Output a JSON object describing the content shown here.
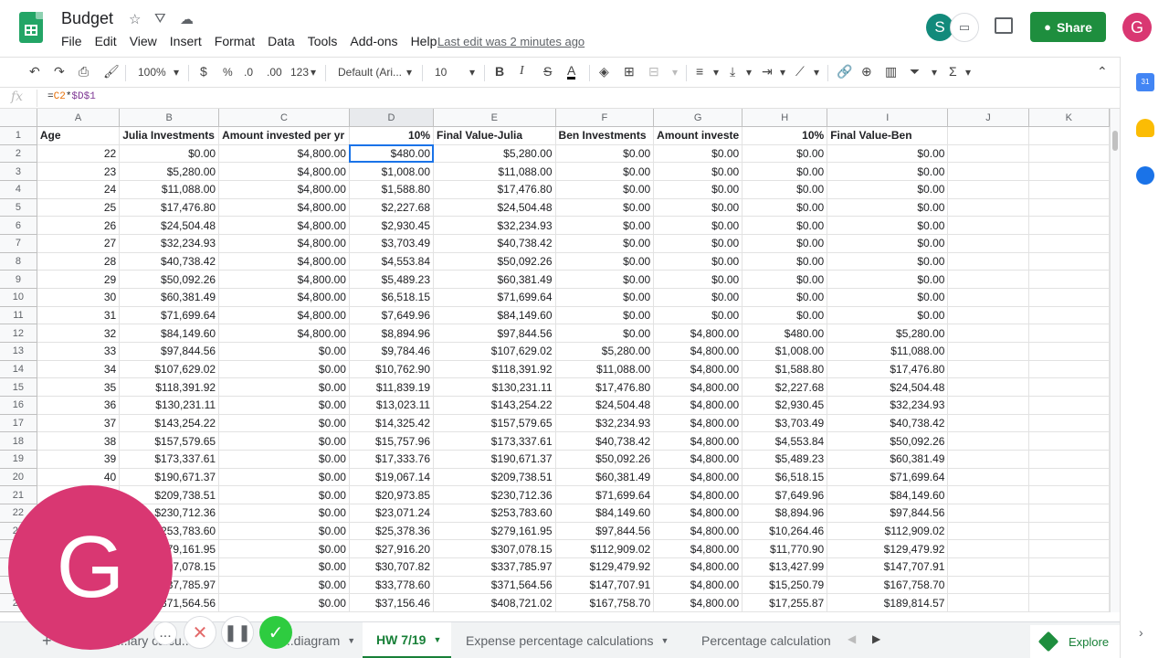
{
  "app": {
    "doc_title": "Budget",
    "last_edit": "Last edit was 2 minutes ago",
    "menu": [
      "File",
      "Edit",
      "View",
      "Insert",
      "Format",
      "Data",
      "Tools",
      "Add-ons",
      "Help"
    ],
    "share_label": "Share",
    "avatar_letter": "G",
    "collab_letter": "S"
  },
  "toolbar": {
    "zoom": "100%",
    "currency": "$",
    "percent": "%",
    "decimal_decrease": ".0",
    "decimal_increase": ".00",
    "number_format": "123",
    "font": "Default (Ari...",
    "font_size": "10",
    "bold": "B",
    "italic": "I",
    "strike": "S",
    "text_color": "A"
  },
  "formula_bar": {
    "fx": "fx",
    "formula_prefix": "=",
    "formula_ref1": "C2",
    "formula_op": "*",
    "formula_ref2": "$D$1"
  },
  "sheet": {
    "columns": [
      "A",
      "B",
      "C",
      "D",
      "E",
      "F",
      "G",
      "H",
      "I",
      "J",
      "K"
    ],
    "header_row": [
      "Age",
      "Julia Investments",
      "Amount invested per yr",
      "10%",
      "Final Value-Julia",
      "Ben Investments",
      "Amount investe",
      "10%",
      "Final Value-Ben",
      "",
      ""
    ],
    "rows": [
      [
        "22",
        "$0.00",
        "$4,800.00",
        "$480.00",
        "$5,280.00",
        "$0.00",
        "$0.00",
        "$0.00",
        "$0.00"
      ],
      [
        "23",
        "$5,280.00",
        "$4,800.00",
        "$1,008.00",
        "$11,088.00",
        "$0.00",
        "$0.00",
        "$0.00",
        "$0.00"
      ],
      [
        "24",
        "$11,088.00",
        "$4,800.00",
        "$1,588.80",
        "$17,476.80",
        "$0.00",
        "$0.00",
        "$0.00",
        "$0.00"
      ],
      [
        "25",
        "$17,476.80",
        "$4,800.00",
        "$2,227.68",
        "$24,504.48",
        "$0.00",
        "$0.00",
        "$0.00",
        "$0.00"
      ],
      [
        "26",
        "$24,504.48",
        "$4,800.00",
        "$2,930.45",
        "$32,234.93",
        "$0.00",
        "$0.00",
        "$0.00",
        "$0.00"
      ],
      [
        "27",
        "$32,234.93",
        "$4,800.00",
        "$3,703.49",
        "$40,738.42",
        "$0.00",
        "$0.00",
        "$0.00",
        "$0.00"
      ],
      [
        "28",
        "$40,738.42",
        "$4,800.00",
        "$4,553.84",
        "$50,092.26",
        "$0.00",
        "$0.00",
        "$0.00",
        "$0.00"
      ],
      [
        "29",
        "$50,092.26",
        "$4,800.00",
        "$5,489.23",
        "$60,381.49",
        "$0.00",
        "$0.00",
        "$0.00",
        "$0.00"
      ],
      [
        "30",
        "$60,381.49",
        "$4,800.00",
        "$6,518.15",
        "$71,699.64",
        "$0.00",
        "$0.00",
        "$0.00",
        "$0.00"
      ],
      [
        "31",
        "$71,699.64",
        "$4,800.00",
        "$7,649.96",
        "$84,149.60",
        "$0.00",
        "$0.00",
        "$0.00",
        "$0.00"
      ],
      [
        "32",
        "$84,149.60",
        "$4,800.00",
        "$8,894.96",
        "$97,844.56",
        "$0.00",
        "$4,800.00",
        "$480.00",
        "$5,280.00"
      ],
      [
        "33",
        "$97,844.56",
        "$0.00",
        "$9,784.46",
        "$107,629.02",
        "$5,280.00",
        "$4,800.00",
        "$1,008.00",
        "$11,088.00"
      ],
      [
        "34",
        "$107,629.02",
        "$0.00",
        "$10,762.90",
        "$118,391.92",
        "$11,088.00",
        "$4,800.00",
        "$1,588.80",
        "$17,476.80"
      ],
      [
        "35",
        "$118,391.92",
        "$0.00",
        "$11,839.19",
        "$130,231.11",
        "$17,476.80",
        "$4,800.00",
        "$2,227.68",
        "$24,504.48"
      ],
      [
        "36",
        "$130,231.11",
        "$0.00",
        "$13,023.11",
        "$143,254.22",
        "$24,504.48",
        "$4,800.00",
        "$2,930.45",
        "$32,234.93"
      ],
      [
        "37",
        "$143,254.22",
        "$0.00",
        "$14,325.42",
        "$157,579.65",
        "$32,234.93",
        "$4,800.00",
        "$3,703.49",
        "$40,738.42"
      ],
      [
        "38",
        "$157,579.65",
        "$0.00",
        "$15,757.96",
        "$173,337.61",
        "$40,738.42",
        "$4,800.00",
        "$4,553.84",
        "$50,092.26"
      ],
      [
        "39",
        "$173,337.61",
        "$0.00",
        "$17,333.76",
        "$190,671.37",
        "$50,092.26",
        "$4,800.00",
        "$5,489.23",
        "$60,381.49"
      ],
      [
        "40",
        "$190,671.37",
        "$0.00",
        "$19,067.14",
        "$209,738.51",
        "$60,381.49",
        "$4,800.00",
        "$6,518.15",
        "$71,699.64"
      ],
      [
        "",
        "$209,738.51",
        "$0.00",
        "$20,973.85",
        "$230,712.36",
        "$71,699.64",
        "$4,800.00",
        "$7,649.96",
        "$84,149.60"
      ],
      [
        "",
        "$230,712.36",
        "$0.00",
        "$23,071.24",
        "$253,783.60",
        "$84,149.60",
        "$4,800.00",
        "$8,894.96",
        "$97,844.56"
      ],
      [
        "",
        "$253,783.60",
        "$0.00",
        "$25,378.36",
        "$279,161.95",
        "$97,844.56",
        "$4,800.00",
        "$10,264.46",
        "$112,909.02"
      ],
      [
        "",
        "79,161.95",
        "$0.00",
        "$27,916.20",
        "$307,078.15",
        "$112,909.02",
        "$4,800.00",
        "$11,770.90",
        "$129,479.92"
      ],
      [
        "",
        "07,078.15",
        "$0.00",
        "$30,707.82",
        "$337,785.97",
        "$129,479.92",
        "$4,800.00",
        "$13,427.99",
        "$147,707.91"
      ],
      [
        "",
        "37,785.97",
        "$0.00",
        "$33,778.60",
        "$371,564.56",
        "$147,707.91",
        "$4,800.00",
        "$15,250.79",
        "$167,758.70"
      ],
      [
        "",
        "371,564.56",
        "$0.00",
        "$37,156.46",
        "$408,721.02",
        "$167,758.70",
        "$4,800.00",
        "$17,255.87",
        "$189,814.57"
      ]
    ]
  },
  "tabs": [
    {
      "label": "...lary calcu...ts",
      "active": false
    },
    {
      "label": "...diagram",
      "active": false
    },
    {
      "label": "HW 7/19",
      "active": true
    },
    {
      "label": "Expense percentage calculations",
      "active": false
    },
    {
      "label": "Percentage calculation",
      "active": false
    }
  ],
  "explore_label": "Explore",
  "recorder": {
    "avatar_letter": "G",
    "more": "...",
    "cancel": "✕",
    "pause": "❚❚",
    "done": "✓"
  },
  "colors": {
    "brand_green": "#1e8e3e",
    "avatar_pink": "#d93772",
    "selection_blue": "#1a73e8"
  }
}
